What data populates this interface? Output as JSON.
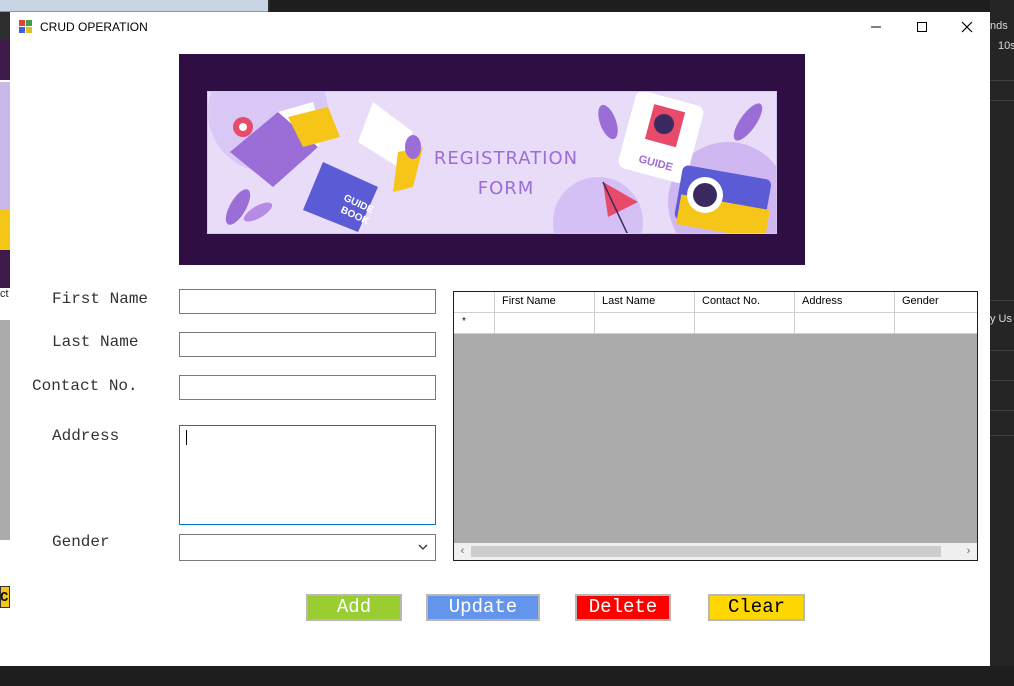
{
  "window": {
    "title": "CRUD OPERATION"
  },
  "banner": {
    "title_line1": "REGISTRATION",
    "title_line2": "FORM",
    "book_text_1": "GUIDE",
    "book_text_2": "BOOK",
    "badge_text": "GUIDE"
  },
  "form": {
    "first_name_label": "First Name",
    "last_name_label": "Last Name",
    "contact_label": "Contact No.",
    "address_label": "Address",
    "gender_label": "Gender",
    "first_name_value": "",
    "last_name_value": "",
    "contact_value": "",
    "address_value": "",
    "gender_value": ""
  },
  "grid": {
    "columns": [
      "First Name",
      "Last Name",
      "Contact No.",
      "Address",
      "Gender"
    ],
    "new_row_marker": "*",
    "rows": []
  },
  "buttons": {
    "add": "Add",
    "update": "Update",
    "delete": "Delete",
    "clear": "Clear"
  },
  "background": {
    "left_fragment_1": "ct",
    "left_fragment_2": "C",
    "right_fragment_1": "nds",
    "right_fragment_2": "10s",
    "right_fragment_3": "y Us"
  },
  "colors": {
    "banner_bg": "#2e0e43",
    "banner_inner": "#e8dcf8",
    "add": "#9acd32",
    "update": "#6495ed",
    "delete": "#ff0000",
    "clear": "#ffd700"
  }
}
